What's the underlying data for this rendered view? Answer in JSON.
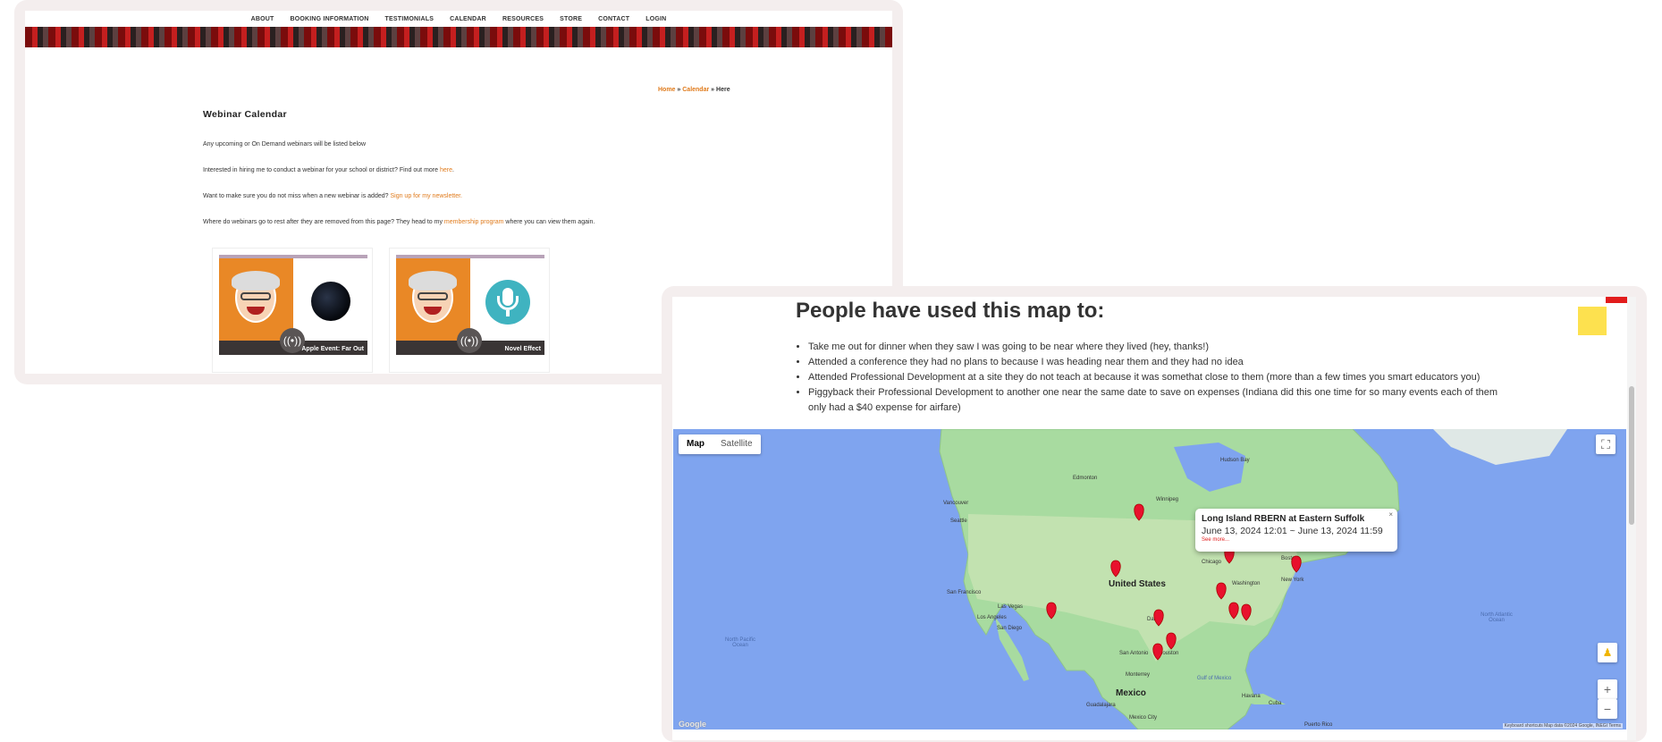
{
  "left_page": {
    "nav": [
      "ABOUT",
      "BOOKING INFORMATION",
      "TESTIMONIALS",
      "CALENDAR",
      "RESOURCES",
      "STORE",
      "CONTACT",
      "LOGIN"
    ],
    "breadcrumb": {
      "home": "Home",
      "sep1": " » ",
      "calendar": "Calendar",
      "sep2": " » ",
      "current": "Here"
    },
    "title": "Webinar Calendar",
    "p1": "Any upcoming or On Demand webinars will be listed below",
    "p2_before": "Interested in hiring me to conduct a webinar for your school or district? Find out more ",
    "p2_link": "here",
    "p2_after": ".",
    "p3_before": "Want to make sure you do not miss when a new webinar is added? ",
    "p3_link": "Sign up for my newsletter.",
    "p4_before": "Where do webinars go to rest after they are removed from this page? They head to my ",
    "p4_link": "membership program",
    "p4_after": " where you can view them again.",
    "cards": [
      {
        "label": "Apple Event: Far Out",
        "icon": "podcast-icon"
      },
      {
        "label": "Novel Effect",
        "icon": "podcast-icon"
      }
    ]
  },
  "right_page": {
    "heading": "People have used this map to:",
    "items": [
      "Take me out for dinner when they saw I was going to be near where they lived (hey, thanks!)",
      "Attended a conference they had no plans to because I was heading near them and they had no idea",
      "Attended Professional Development at a site they do not teach at because it was somethat close to them (more than a few times you smart educators you)",
      "Piggyback their Professional Development to another one near the same date to save on expenses (Indiana did this one time for so many events each of them only had a $40 expense for airfare)"
    ],
    "map": {
      "type_map": "Map",
      "type_satellite": "Satellite",
      "infowindow": {
        "title": "Long Island RBERN at Eastern Suffolk",
        "date": "June 13, 2024 12:01 ~ June 13, 2024 11:59",
        "more": "See more...",
        "close": "×"
      },
      "labels": {
        "us": "United States",
        "mexico": "Mexico",
        "vancouver": "Vancouver",
        "seattle": "Seattle",
        "winnipeg": "Winnipeg",
        "chicago": "Chicago",
        "boston": "Boston",
        "newyork": "New York",
        "washington": "Washington",
        "sf": "San Francisco",
        "lasvegas": "Las Vegas",
        "la": "Los Angeles",
        "sandiego": "San Diego",
        "dallas": "Dallas",
        "houston": "Houston",
        "sanantonio": "San Antonio",
        "monterrey": "Monterrey",
        "havana": "Havana",
        "cuba": "Cuba",
        "guadalajara": "Guadalajara",
        "mexicocity": "Mexico City",
        "puertorico": "Puerto Rico",
        "gulf": "Gulf of Mexico",
        "npacific": "North Pacific Ocean",
        "natlantic": "North Atlantic Ocean",
        "edmonton": "Edmonton",
        "hudson": "Hudson Bay"
      },
      "attribution": "Keyboard shortcuts   Map data ©2024 Google, INEGI   Terms",
      "google": "Google",
      "marker_color": "#e8112d",
      "land_color": "#a8dba0",
      "water_color": "#7fa4ef"
    }
  },
  "colors": {
    "accent": "#e07b1c",
    "frame": "#f4eeee"
  }
}
